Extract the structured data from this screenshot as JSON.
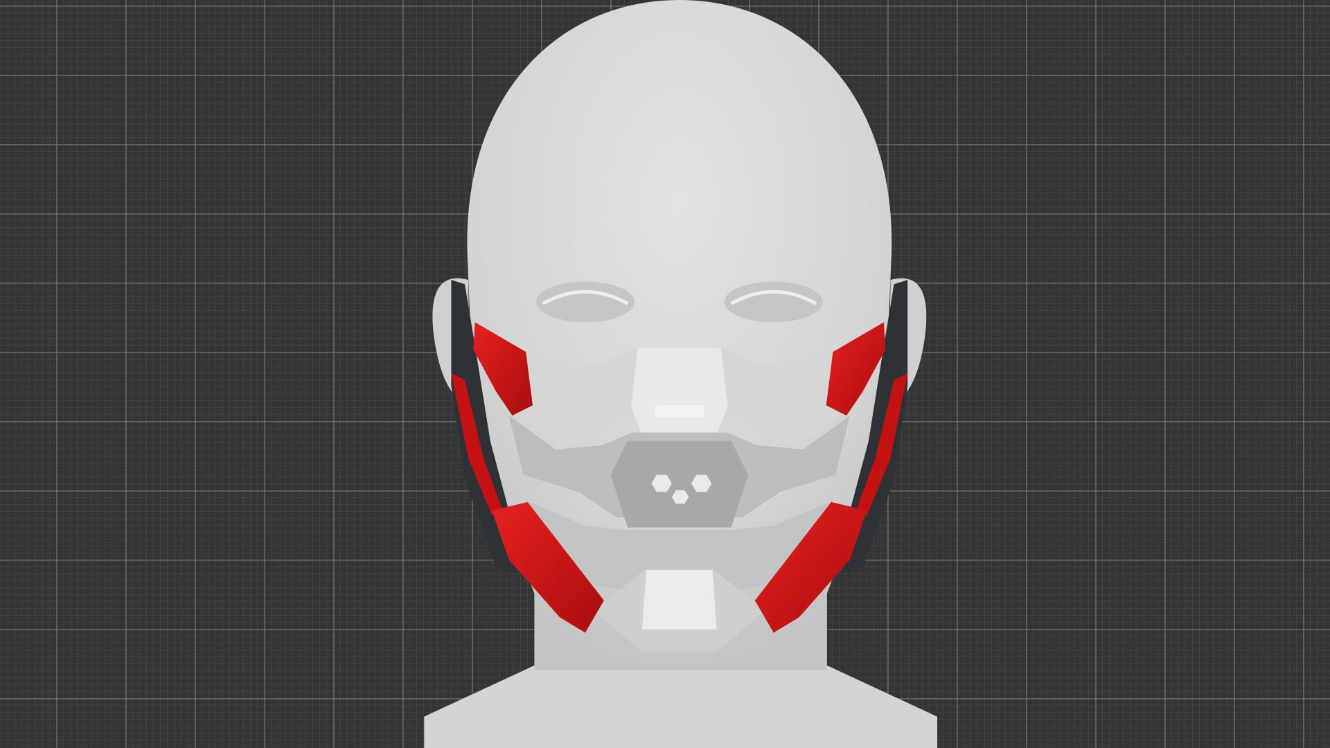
{
  "scene": {
    "subject": "head-with-mask",
    "colors": {
      "background": "#343434",
      "grid_major": "#555555",
      "grid_minor": "#3c3c3c",
      "head": "#d9d9d9",
      "mask_light": "#e4e4e4",
      "mask_mid": "#bcbcbc",
      "mask_dark": "#9e9e9e",
      "accent_red": "#d21414",
      "strap_dark": "#2e3136"
    }
  }
}
